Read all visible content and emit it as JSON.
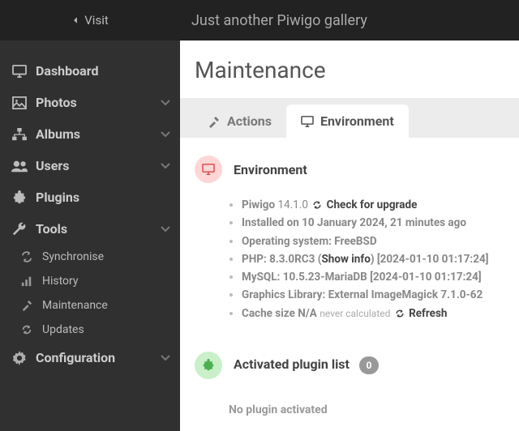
{
  "header": {
    "visit_label": "Visit",
    "site_title": "Just another Piwigo gallery"
  },
  "sidebar": {
    "items": [
      {
        "label": "Dashboard",
        "expandable": false
      },
      {
        "label": "Photos",
        "expandable": true
      },
      {
        "label": "Albums",
        "expandable": true
      },
      {
        "label": "Users",
        "expandable": true
      },
      {
        "label": "Plugins",
        "expandable": false
      },
      {
        "label": "Tools",
        "expandable": true,
        "expanded": true,
        "children": [
          {
            "label": "Synchronise"
          },
          {
            "label": "History"
          },
          {
            "label": "Maintenance"
          },
          {
            "label": "Updates"
          }
        ]
      },
      {
        "label": "Configuration",
        "expandable": true
      }
    ]
  },
  "page": {
    "title": "Maintenance",
    "tabs": [
      {
        "label": "Actions",
        "active": false
      },
      {
        "label": "Environment",
        "active": true
      }
    ]
  },
  "env": {
    "heading": "Environment",
    "piwigo_prefix": "Piwigo",
    "piwigo_version": "14.1.0",
    "upgrade_label": "Check for upgrade",
    "installed": "Installed on 10 January 2024, 21 minutes ago",
    "os": "Operating system: FreeBSD",
    "php_prefix": "PHP: 8.3.0RC3 (",
    "php_show": "Show info",
    "php_suffix": ") [2024-01-10 01:17:24]",
    "mysql": "MySQL: 10.5.23-MariaDB [2024-01-10 01:17:24]",
    "gfx": "Graphics Library: External ImageMagick 7.1.0-62",
    "cache_prefix": "Cache size N/A",
    "cache_note": "never calculated",
    "refresh_label": "Refresh"
  },
  "plugins": {
    "heading": "Activated plugin list",
    "count": "0",
    "empty": "No plugin activated"
  }
}
